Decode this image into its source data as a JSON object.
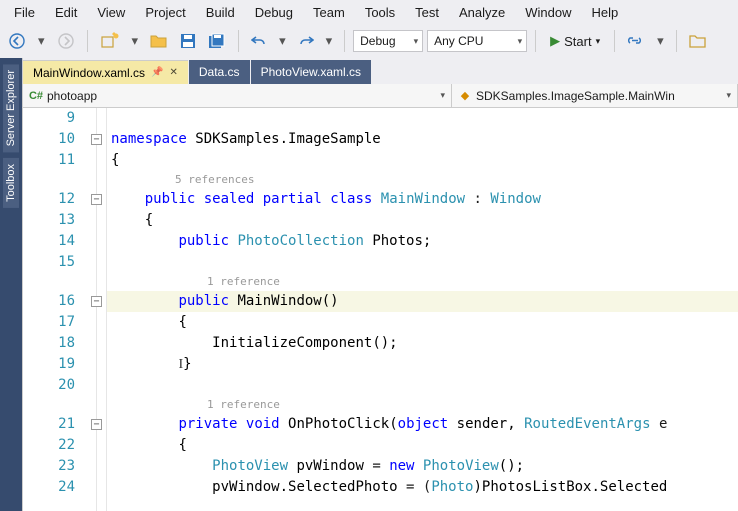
{
  "menu": {
    "file": "File",
    "edit": "Edit",
    "view": "View",
    "project": "Project",
    "build": "Build",
    "debug": "Debug",
    "team": "Team",
    "tools": "Tools",
    "test": "Test",
    "analyze": "Analyze",
    "window": "Window",
    "help": "Help"
  },
  "toolbar": {
    "config": "Debug",
    "platform": "Any CPU",
    "start": "Start"
  },
  "side": {
    "serverExplorer": "Server Explorer",
    "toolbox": "Toolbox"
  },
  "tabs": [
    {
      "label": "MainWindow.xaml.cs",
      "active": true
    },
    {
      "label": "Data.cs",
      "active": false
    },
    {
      "label": "PhotoView.xaml.cs",
      "active": false
    }
  ],
  "nav": {
    "left": "photoapp",
    "right": "SDKSamples.ImageSample.MainWin"
  },
  "code": {
    "lines": [
      {
        "n": 9,
        "kind": "blank",
        "text": ""
      },
      {
        "n": 10,
        "kind": "code",
        "parts": [
          [
            "kw",
            "namespace"
          ],
          [
            "sp",
            " "
          ],
          [
            "id",
            "SDKSamples.ImageSample"
          ]
        ]
      },
      {
        "n": 11,
        "kind": "code",
        "parts": [
          [
            "pn",
            "{"
          ]
        ]
      },
      {
        "kind": "ref",
        "text": "5 references",
        "indent": 8
      },
      {
        "n": 12,
        "kind": "code",
        "parts": [
          [
            "sp",
            "    "
          ],
          [
            "kw",
            "public"
          ],
          [
            "sp",
            " "
          ],
          [
            "kw",
            "sealed"
          ],
          [
            "sp",
            " "
          ],
          [
            "kw",
            "partial"
          ],
          [
            "sp",
            " "
          ],
          [
            "kw",
            "class"
          ],
          [
            "sp",
            " "
          ],
          [
            "ty",
            "MainWindow"
          ],
          [
            "sp",
            " : "
          ],
          [
            "ty",
            "Window"
          ]
        ]
      },
      {
        "n": 13,
        "kind": "code",
        "parts": [
          [
            "sp",
            "    "
          ],
          [
            "pn",
            "{"
          ]
        ]
      },
      {
        "n": 14,
        "kind": "code",
        "parts": [
          [
            "sp",
            "        "
          ],
          [
            "kw",
            "public"
          ],
          [
            "sp",
            " "
          ],
          [
            "ty",
            "PhotoCollection"
          ],
          [
            "sp",
            " "
          ],
          [
            "id",
            "Photos"
          ],
          [
            "pn",
            ";"
          ]
        ]
      },
      {
        "n": 15,
        "kind": "blank",
        "text": ""
      },
      {
        "kind": "ref",
        "text": "1 reference",
        "indent": 12
      },
      {
        "n": 16,
        "kind": "code",
        "hl": true,
        "parts": [
          [
            "sp",
            "        "
          ],
          [
            "kw",
            "public"
          ],
          [
            "sp",
            " "
          ],
          [
            "id",
            "MainWindow"
          ],
          [
            "pn",
            "()"
          ]
        ]
      },
      {
        "n": 17,
        "kind": "code",
        "parts": [
          [
            "sp",
            "        "
          ],
          [
            "pn",
            "{"
          ]
        ]
      },
      {
        "n": 18,
        "kind": "code",
        "parts": [
          [
            "sp",
            "            "
          ],
          [
            "id",
            "InitializeComponent"
          ],
          [
            "pn",
            "();"
          ]
        ]
      },
      {
        "n": 19,
        "kind": "code",
        "parts": [
          [
            "sp",
            "        "
          ],
          [
            "caret",
            "I"
          ],
          [
            "pn",
            "}"
          ]
        ]
      },
      {
        "n": 20,
        "kind": "blank",
        "text": ""
      },
      {
        "kind": "ref",
        "text": "1 reference",
        "indent": 12
      },
      {
        "n": 21,
        "kind": "code",
        "parts": [
          [
            "sp",
            "        "
          ],
          [
            "kw",
            "private"
          ],
          [
            "sp",
            " "
          ],
          [
            "kw",
            "void"
          ],
          [
            "sp",
            " "
          ],
          [
            "id",
            "OnPhotoClick"
          ],
          [
            "pn",
            "("
          ],
          [
            "kw",
            "object"
          ],
          [
            "sp",
            " "
          ],
          [
            "id",
            "sender"
          ],
          [
            "pn",
            ", "
          ],
          [
            "ty",
            "RoutedEventArgs"
          ],
          [
            "sp",
            " e"
          ]
        ]
      },
      {
        "n": 22,
        "kind": "code",
        "parts": [
          [
            "sp",
            "        "
          ],
          [
            "pn",
            "{"
          ]
        ]
      },
      {
        "n": 23,
        "kind": "code",
        "parts": [
          [
            "sp",
            "            "
          ],
          [
            "ty",
            "PhotoView"
          ],
          [
            "sp",
            " "
          ],
          [
            "id",
            "pvWindow"
          ],
          [
            "sp",
            " = "
          ],
          [
            "kw",
            "new"
          ],
          [
            "sp",
            " "
          ],
          [
            "ty",
            "PhotoView"
          ],
          [
            "pn",
            "();"
          ]
        ]
      },
      {
        "n": 24,
        "kind": "code",
        "parts": [
          [
            "sp",
            "            "
          ],
          [
            "id",
            "pvWindow.SelectedPhoto"
          ],
          [
            "sp",
            " = ("
          ],
          [
            "ty",
            "Photo"
          ],
          [
            "pn",
            ")"
          ],
          [
            "id",
            "PhotosListBox.Selected"
          ]
        ]
      }
    ],
    "folds": [
      10,
      12,
      16,
      21
    ]
  }
}
